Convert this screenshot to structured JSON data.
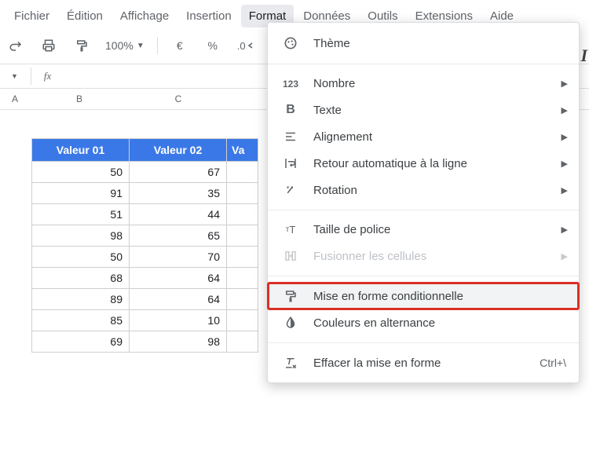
{
  "menubar": {
    "items": [
      "Fichier",
      "Édition",
      "Affichage",
      "Insertion",
      "Format",
      "Données",
      "Outils",
      "Extensions",
      "Aide"
    ],
    "activeIndex": 4
  },
  "toolbar": {
    "zoom": "100%",
    "currency": "€",
    "percent": "%",
    "decimal": ".0",
    "italicHint": "I"
  },
  "fxrow": {
    "cell": "",
    "fx": "fx"
  },
  "columns": [
    "A",
    "B",
    "C"
  ],
  "table": {
    "headers": [
      "Valeur 01",
      "Valeur 02",
      "Va"
    ],
    "rows": [
      [
        50,
        67
      ],
      [
        91,
        35
      ],
      [
        51,
        44
      ],
      [
        98,
        65
      ],
      [
        50,
        70
      ],
      [
        68,
        64
      ],
      [
        89,
        64
      ],
      [
        85,
        10
      ],
      [
        69,
        98
      ]
    ]
  },
  "dropdown": {
    "theme": "Thème",
    "number": "Nombre",
    "text": "Texte",
    "align": "Alignement",
    "wrap": "Retour automatique à la ligne",
    "rotation": "Rotation",
    "fontsize": "Taille de police",
    "merge": "Fusionner les cellules",
    "condformat": "Mise en forme conditionnelle",
    "altcolors": "Couleurs en alternance",
    "clearformat": "Effacer la mise en forme",
    "clearformat_shortcut": "Ctrl+\\"
  }
}
